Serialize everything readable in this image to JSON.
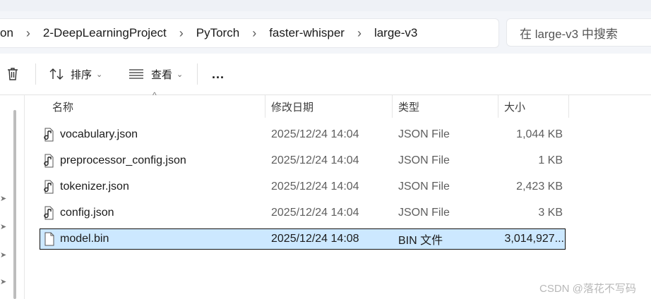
{
  "breadcrumb": {
    "items": [
      "on",
      "2-DeepLearningProject",
      "PyTorch",
      "faster-whisper",
      "large-v3"
    ]
  },
  "search": {
    "placeholder": "在 large-v3 中搜索"
  },
  "toolbar": {
    "delete_icon": "trash-icon",
    "sort_label": "排序",
    "view_label": "查看",
    "more_label": "..."
  },
  "columns": {
    "name": "名称",
    "modified": "修改日期",
    "type": "类型",
    "size": "大小"
  },
  "files": [
    {
      "name": "vocabulary.json",
      "modified": "2025/12/24 14:04",
      "type": "JSON File",
      "size": "1,044 KB",
      "icon": "json-file-icon",
      "selected": false
    },
    {
      "name": "preprocessor_config.json",
      "modified": "2025/12/24 14:04",
      "type": "JSON File",
      "size": "1 KB",
      "icon": "json-file-icon",
      "selected": false
    },
    {
      "name": "tokenizer.json",
      "modified": "2025/12/24 14:04",
      "type": "JSON File",
      "size": "2,423 KB",
      "icon": "json-file-icon",
      "selected": false
    },
    {
      "name": "config.json",
      "modified": "2025/12/24 14:04",
      "type": "JSON File",
      "size": "3 KB",
      "icon": "json-file-icon",
      "selected": false
    },
    {
      "name": "model.bin",
      "modified": "2025/12/24 14:08",
      "type": "BIN 文件",
      "size": "3,014,927...",
      "icon": "blank-file-icon",
      "selected": true
    }
  ],
  "watermark": "CSDN @落花不写码",
  "colors": {
    "selection": "#cce8ff",
    "selection_border": "#0f0f0f"
  }
}
